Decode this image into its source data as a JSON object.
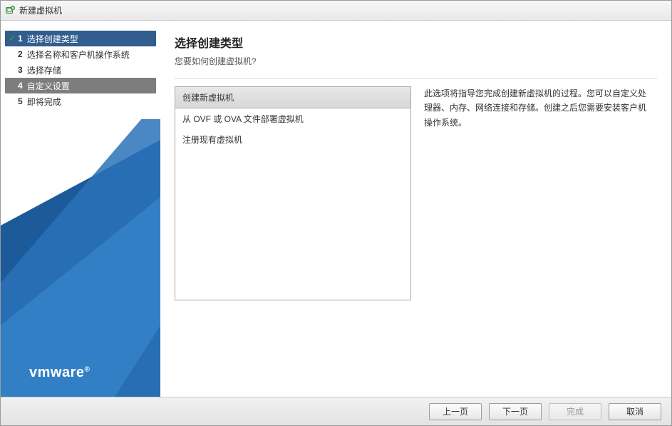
{
  "window": {
    "title": "新建虚拟机"
  },
  "sidebar": {
    "steps": [
      {
        "num": "1",
        "label": "选择创建类型",
        "selected": true,
        "checked": true
      },
      {
        "num": "2",
        "label": "选择名称和客户机操作系统",
        "selected": false,
        "checked": false
      },
      {
        "num": "3",
        "label": "选择存储",
        "selected": false,
        "checked": false
      },
      {
        "num": "4",
        "label": "自定义设置",
        "selected": false,
        "checked": false,
        "active": true
      },
      {
        "num": "5",
        "label": "即将完成",
        "selected": false,
        "checked": false
      }
    ],
    "logo": "vmware"
  },
  "main": {
    "heading": "选择创建类型",
    "subtitle": "您要如何创建虚拟机?",
    "options": [
      {
        "label": "创建新虚拟机",
        "selected": true
      },
      {
        "label": "从 OVF 或 OVA 文件部署虚拟机",
        "selected": false
      },
      {
        "label": "注册现有虚拟机",
        "selected": false
      }
    ],
    "description": "此选项将指导您完成创建新虚拟机的过程。您可以自定义处理器、内存、网络连接和存储。创建之后您需要安装客户机操作系统。"
  },
  "footer": {
    "back": "上一页",
    "next": "下一页",
    "finish": "完成",
    "cancel": "取消"
  }
}
